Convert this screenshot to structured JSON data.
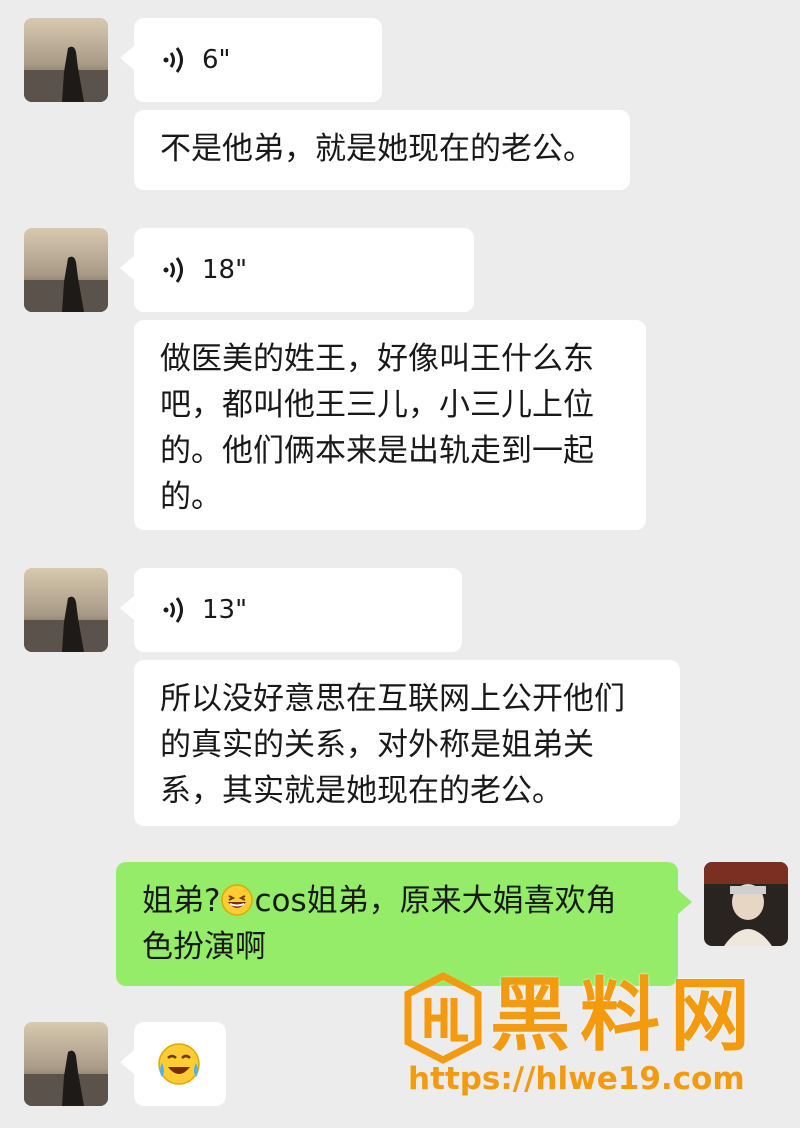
{
  "messages": [
    {
      "voice_duration": "6\""
    },
    {
      "text": "不是他弟，就是她现在的老公。"
    },
    {
      "voice_duration": "18\""
    },
    {
      "lines": [
        "做医美的姓王，好像叫王什么东",
        "吧，都叫他王三儿，小三儿上位",
        "的。他们俩本来是出轨走到一起",
        "的。"
      ]
    },
    {
      "voice_duration": "13\""
    },
    {
      "lines": [
        "所以没好意思在互联网上公开他们",
        "的真实的关系，对外称是姐弟关",
        "系，其实就是她现在的老公。"
      ]
    },
    {
      "line1_a": "姐弟?",
      "line1_b": "cos姐弟，原来大娟喜欢角",
      "line2": "色扮演啊"
    },
    {
      "emoji": "crying-laughing-emoji"
    }
  ],
  "watermark": {
    "title": "黑料网",
    "url": "https://hlwe19.com"
  },
  "colors": {
    "background": "#ececec",
    "incoming_bubble": "#ffffff",
    "outgoing_bubble": "#95ec69",
    "watermark": "#f39a0e"
  }
}
